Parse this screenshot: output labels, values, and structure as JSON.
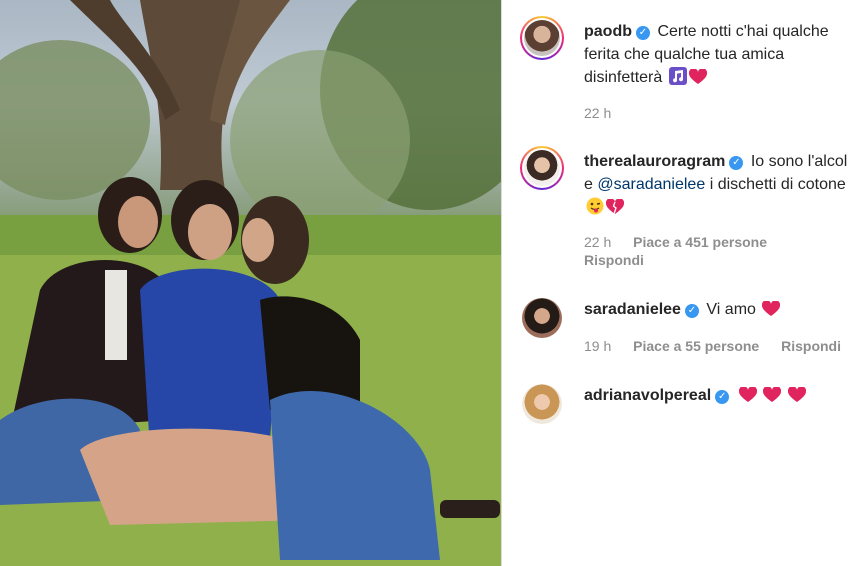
{
  "post": {
    "photo_alt": "",
    "caption": {
      "username": "paodb",
      "verified": true,
      "text": "Certe notti c'hai qualche ferita che qualche tua amica disinfetterà",
      "emojis": [
        "music-notes",
        "red-heart"
      ],
      "time": "22 h"
    }
  },
  "comments": [
    {
      "username": "therealauroragram",
      "verified": true,
      "text_before": "Io sono l'alcol e",
      "mention": "@saradanielee",
      "text_after": "i dischetti di cotone",
      "emojis": [
        "winking-tongue-face",
        "broken-heart"
      ],
      "time": "22 h",
      "likes": "Piace a 451 persone",
      "reply": "Rispondi"
    },
    {
      "username": "saradanielee",
      "verified": true,
      "text": "Vi amo",
      "emojis": [
        "red-heart"
      ],
      "time": "19 h",
      "likes": "Piace a 55 persone",
      "reply": "Rispondi"
    },
    {
      "username": "adrianavolpereal",
      "verified": true,
      "text": "",
      "emojis": [
        "red-heart",
        "red-heart",
        "red-heart"
      ]
    }
  ],
  "colors": {
    "verified": "#3897f0",
    "text": "#262626",
    "meta": "#8e8e8e",
    "mention": "#00376b",
    "heart": "#e0245e"
  }
}
